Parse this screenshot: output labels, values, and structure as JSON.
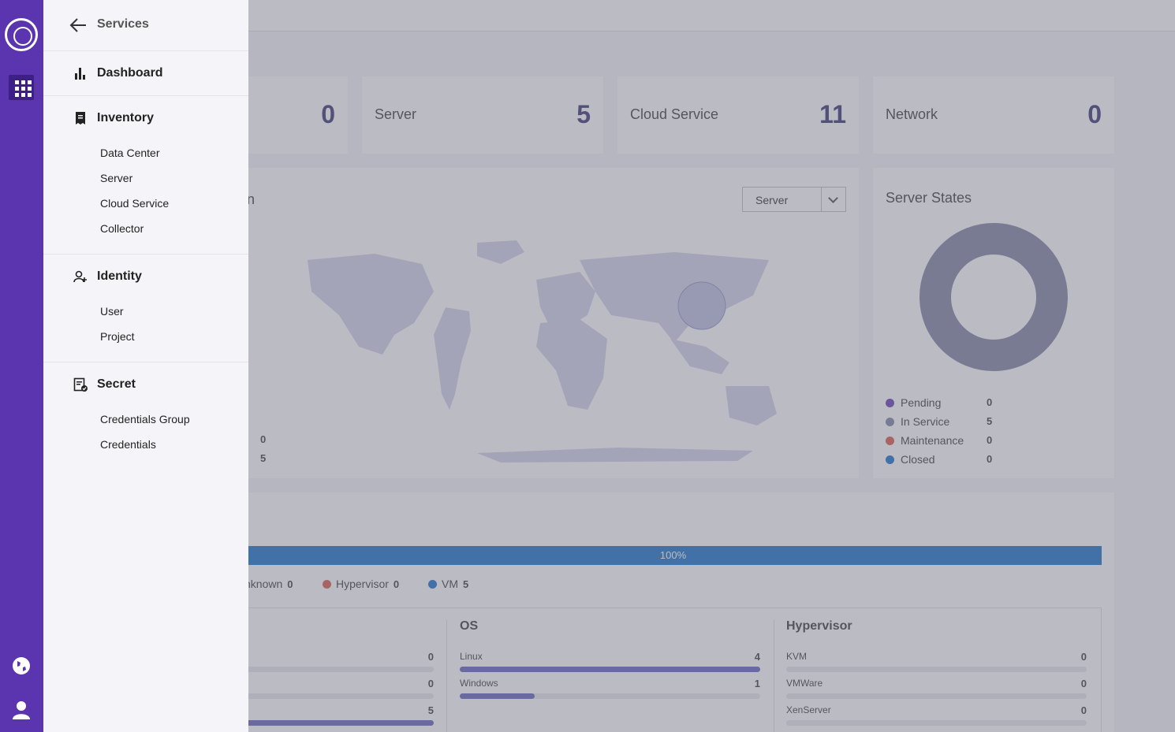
{
  "rail": {
    "logo_icon": "cloudforet-logo-icon",
    "apps_icon": "grid-apps-icon",
    "globe_icon": "globe-icon",
    "user_icon": "user-icon"
  },
  "stats": [
    {
      "label": "",
      "value": "0"
    },
    {
      "label": "Server",
      "value": "5"
    },
    {
      "label": "Cloud Service",
      "value": "11"
    },
    {
      "label": "Network",
      "value": "0"
    }
  ],
  "map_panel": {
    "title_fragment": "n",
    "dropdown_value": "Server",
    "counts": [
      "0",
      "5"
    ]
  },
  "server_states": {
    "title": "Server States",
    "legend": [
      {
        "label": "Pending",
        "value": "0",
        "color": "#5b34b0"
      },
      {
        "label": "In Service",
        "value": "5",
        "color": "#7a7f9e"
      },
      {
        "label": "Maintenance",
        "value": "0",
        "color": "#d4533f"
      },
      {
        "label": "Closed",
        "value": "0",
        "color": "#0d6ac8"
      }
    ]
  },
  "server_type": {
    "progress_label": "100%",
    "progress_value": 1.0,
    "legend": [
      {
        "label": "nknown",
        "value": "0",
        "color": ""
      },
      {
        "label": "Hypervisor",
        "value": "0",
        "color": "#d4533f"
      },
      {
        "label": "VM",
        "value": "5",
        "color": "#0d6ac8"
      }
    ]
  },
  "breakdown": {
    "first_col_values": [
      "0",
      "0",
      "5"
    ],
    "first_col_fill": [
      0,
      0,
      1.0
    ],
    "os": {
      "title": "OS",
      "rows": [
        {
          "label": "Linux",
          "value": "4",
          "fraction": 1.0
        },
        {
          "label": "Windows",
          "value": "1",
          "fraction": 0.25
        }
      ]
    },
    "hypervisor": {
      "title": "Hypervisor",
      "rows": [
        {
          "label": "KVM",
          "value": "0",
          "fraction": 0
        },
        {
          "label": "VMWare",
          "value": "0",
          "fraction": 0
        },
        {
          "label": "XenServer",
          "value": "0",
          "fraction": 0
        }
      ]
    }
  },
  "menu": {
    "title": "Services",
    "back_icon": "arrow-left-icon",
    "sections": [
      {
        "label": "Dashboard",
        "icon": "bar-chart-icon",
        "items": []
      },
      {
        "label": "Inventory",
        "icon": "inventory-icon",
        "items": [
          "Data Center",
          "Server",
          "Cloud Service",
          "Collector"
        ]
      },
      {
        "label": "Identity",
        "icon": "identity-icon",
        "items": [
          "User",
          "Project"
        ]
      },
      {
        "label": "Secret",
        "icon": "secret-icon",
        "items": [
          "Credentials Group",
          "Credentials"
        ]
      }
    ]
  }
}
